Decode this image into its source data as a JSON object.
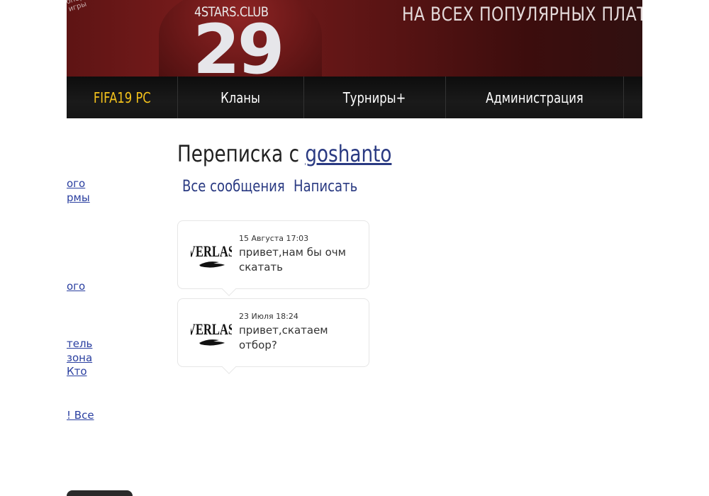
{
  "banner": {
    "logo_text": "оперни\nигры",
    "club": "4STARS.CLUB",
    "number": "29",
    "tagline": "НА ВСЕХ ПОПУЛЯРНЫХ ПЛАТФО"
  },
  "nav": {
    "items": [
      {
        "label": "FIFA19 PC",
        "active": true
      },
      {
        "label": "Кланы"
      },
      {
        "label": "Турниры+"
      },
      {
        "label": "Администрация"
      }
    ]
  },
  "sidebar": {
    "links": [
      "ого",
      "рмы",
      "ого",
      "тель",
      "зона",
      " Кто",
      "! Все"
    ]
  },
  "conversation": {
    "title_prefix": "Переписка с ",
    "username": "goshanto",
    "tabs": [
      "Все сообщения",
      "Написать"
    ],
    "messages": [
      {
        "avatar_text": "VERLAS",
        "date": "15 Августа 17:03",
        "text": "привет,нам бы очм скатать"
      },
      {
        "avatar_text": "VERLAS",
        "date": "23 Июля 18:24",
        "text": "привет,скатаем отбор?"
      }
    ]
  },
  "colors": {
    "nav_active": "#f4c21b",
    "link": "#2a3a82",
    "banner": "#7a1c1c"
  }
}
